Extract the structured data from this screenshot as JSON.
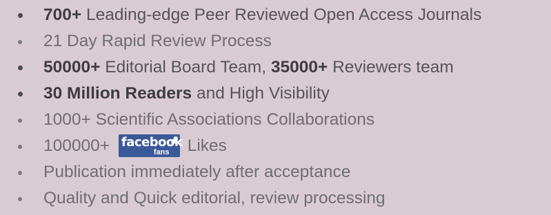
{
  "features": {
    "item1": {
      "bold": "700+",
      "text": " Leading-edge Peer Reviewed Open Access Journals"
    },
    "item2": {
      "text": "21 Day Rapid Review Process"
    },
    "item3": {
      "bold1": "50000+",
      "text1": " Editorial Board Team, ",
      "bold2": "35000+",
      "text2": " Reviewers team"
    },
    "item4": {
      "bold": "30 Million Readers",
      "text": " and High Visibility"
    },
    "item5": {
      "text": "1000+ Scientific Associations Collaborations"
    },
    "item6": {
      "prefix": "100000+",
      "badge_word": "facebook",
      "badge_sub": "fans",
      "suffix": "Likes"
    },
    "item7": {
      "text": "Publication immediately after acceptance"
    },
    "item8": {
      "text": "Quality and Quick editorial, review processing"
    }
  },
  "colors": {
    "background": "#d9cbd3",
    "text": "#6e6e6e",
    "bold_text": "#3d3d3d",
    "facebook_blue": "#3b5998"
  },
  "icons": {
    "bullet": "bullet-dot-icon",
    "facebook": "facebook-fans-badge-icon",
    "thumb": "thumbs-up-icon"
  }
}
